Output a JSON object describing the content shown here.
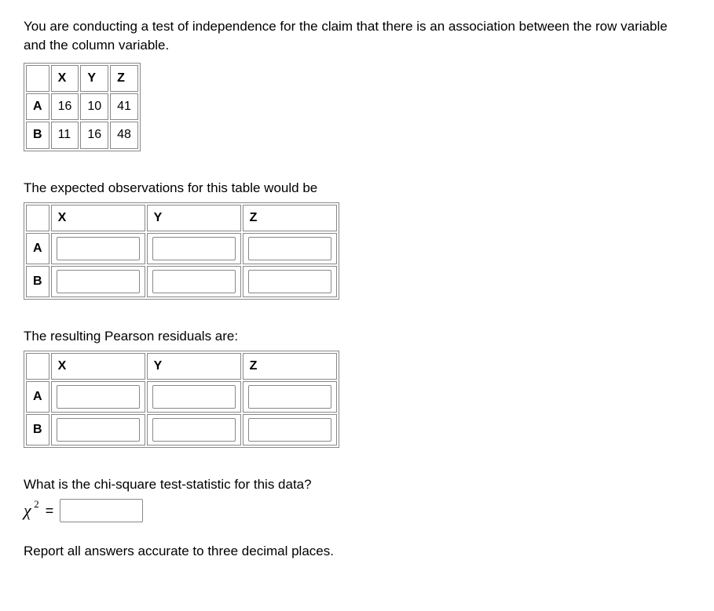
{
  "intro": "You are conducting a test of independence for the claim that there is an association between the row variable and the column variable.",
  "observed": {
    "cols": [
      "X",
      "Y",
      "Z"
    ],
    "rows": [
      {
        "label": "A",
        "vals": [
          "16",
          "10",
          "41"
        ]
      },
      {
        "label": "B",
        "vals": [
          "11",
          "16",
          "48"
        ]
      }
    ]
  },
  "expected": {
    "label": "The expected observations for this table would be",
    "cols": [
      "X",
      "Y",
      "Z"
    ],
    "rows": [
      "A",
      "B"
    ]
  },
  "residuals": {
    "label": "The resulting Pearson residuals are:",
    "cols": [
      "X",
      "Y",
      "Z"
    ],
    "rows": [
      "A",
      "B"
    ]
  },
  "chisq": {
    "question": "What is the chi-square test-statistic for this data?",
    "symbol": "χ",
    "sup": "2",
    "eq": "="
  },
  "footer": "Report all answers accurate to three decimal places."
}
